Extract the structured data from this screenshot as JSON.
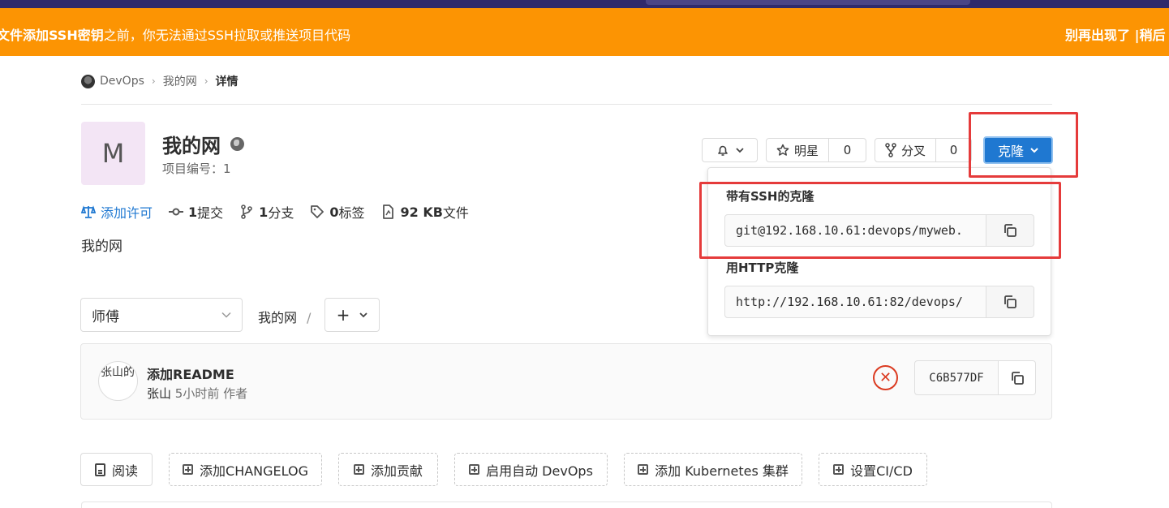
{
  "banner": {
    "message_bold": "文件添加SSH密钥",
    "message_rest": "之前，你无法通过SSH拉取或推送项目代码",
    "dismiss": "别再出现了",
    "separator": " |",
    "later": "稍后"
  },
  "breadcrumb": {
    "group": "DevOps",
    "project": "我的网",
    "current": "详情"
  },
  "project": {
    "avatar_letter": "M",
    "name": "我的网",
    "id_text": "项目编号：1",
    "description": "我的网",
    "visibility_icon": "globe-icon"
  },
  "stats": {
    "license": "添加许可",
    "commits_count": "1",
    "commits_label": "提交",
    "branches_count": "1",
    "branches_label": "分支",
    "tags_count": "0",
    "tags_label": "标签",
    "files_size": "92 KB",
    "files_label": "文件"
  },
  "header_buttons": {
    "star_label": "明星",
    "star_count": "0",
    "fork_label": "分叉",
    "fork_count": "0",
    "clone_label": "克隆"
  },
  "clone_dropdown": {
    "ssh_label": "带有SSH的克隆",
    "ssh_url": "git@192.168.10.61:devops/myweb.",
    "http_label": "用HTTP克隆",
    "http_url": "http://192.168.10.61:82/devops/"
  },
  "tree": {
    "branch": "师傅",
    "path_root": "我的网",
    "path_sep": "/",
    "add_symbol": "+"
  },
  "commit": {
    "avatar_alt": "张山的",
    "title": "添加README",
    "author": "张山",
    "time": "5小时前",
    "role": "作者",
    "sha": "C6B577DF"
  },
  "quick_actions": [
    {
      "label": "阅读"
    },
    {
      "label": "添加CHANGELOG"
    },
    {
      "label": "添加贡献"
    },
    {
      "label": "启用自动 DevOps"
    },
    {
      "label": "添加 Kubernetes 集群"
    },
    {
      "label": "设置CI/CD"
    }
  ],
  "colors": {
    "banner": "#fc9403",
    "primary": "#1f78d1",
    "highlight": "#e53b3b",
    "pipeline_failed": "#db3b21"
  }
}
